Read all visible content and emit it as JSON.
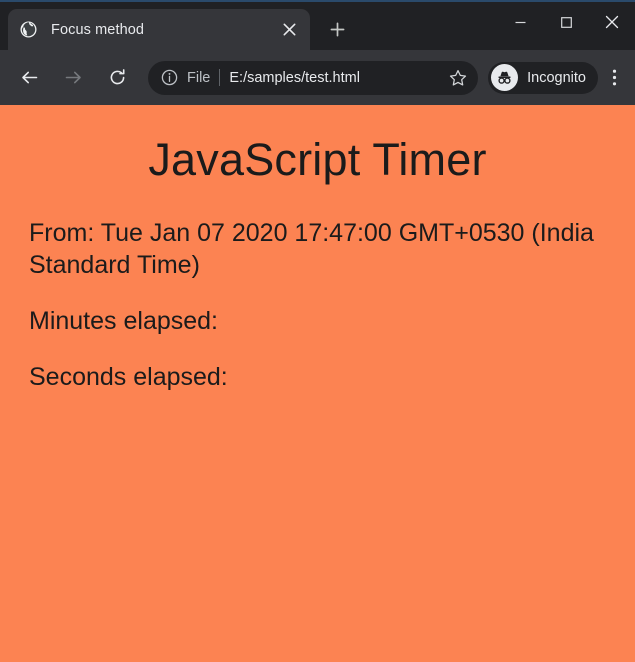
{
  "browser": {
    "tab": {
      "favicon": "globe-icon",
      "title": "Focus method",
      "close_label": "×"
    },
    "new_tab_label": "+",
    "window_controls": {
      "minimize": "minimize-icon",
      "maximize": "maximize-icon",
      "close": "close-icon"
    },
    "toolbar": {
      "back": "back-arrow-icon",
      "forward": "forward-arrow-icon",
      "reload": "reload-icon",
      "omnibox": {
        "info_icon": "info-circle-icon",
        "scheme_label": "File",
        "url": "E:/samples/test.html",
        "star": "bookmark-star-icon"
      },
      "incognito": {
        "icon": "incognito-hat-glasses-icon",
        "label": "Incognito"
      },
      "menu": "three-dot-menu-icon"
    }
  },
  "page": {
    "heading": "JavaScript Timer",
    "from_line": "From: Tue Jan 07 2020 17:47:00 GMT+0530 (India Standard Time)",
    "minutes_line": "Minutes elapsed:",
    "seconds_line": "Seconds elapsed:",
    "background_color": "#fc8352",
    "text_color": "#1b1b1b"
  }
}
